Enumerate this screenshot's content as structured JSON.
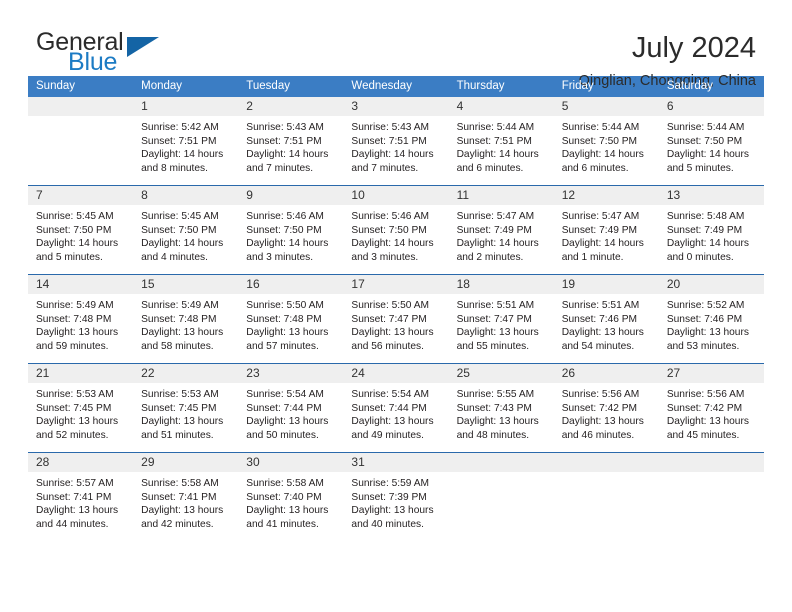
{
  "brand": {
    "name_top": "General",
    "name_bottom": "Blue",
    "accent_color": "#1c7bc4",
    "triangle_color": "#1464a5"
  },
  "header": {
    "title": "July 2024",
    "subtitle": "Qinglian, Chongqing, China"
  },
  "theme": {
    "header_row_bg": "#3b7dc4",
    "row_divider": "#2a69ab",
    "daynum_strip_bg": "#efefef",
    "text": "#231f20"
  },
  "weekdays": [
    "Sunday",
    "Monday",
    "Tuesday",
    "Wednesday",
    "Thursday",
    "Friday",
    "Saturday"
  ],
  "weeks": [
    [
      {
        "day": "",
        "lines": []
      },
      {
        "day": "1",
        "lines": [
          "Sunrise: 5:42 AM",
          "Sunset: 7:51 PM",
          "Daylight: 14 hours",
          "and 8 minutes."
        ]
      },
      {
        "day": "2",
        "lines": [
          "Sunrise: 5:43 AM",
          "Sunset: 7:51 PM",
          "Daylight: 14 hours",
          "and 7 minutes."
        ]
      },
      {
        "day": "3",
        "lines": [
          "Sunrise: 5:43 AM",
          "Sunset: 7:51 PM",
          "Daylight: 14 hours",
          "and 7 minutes."
        ]
      },
      {
        "day": "4",
        "lines": [
          "Sunrise: 5:44 AM",
          "Sunset: 7:51 PM",
          "Daylight: 14 hours",
          "and 6 minutes."
        ]
      },
      {
        "day": "5",
        "lines": [
          "Sunrise: 5:44 AM",
          "Sunset: 7:50 PM",
          "Daylight: 14 hours",
          "and 6 minutes."
        ]
      },
      {
        "day": "6",
        "lines": [
          "Sunrise: 5:44 AM",
          "Sunset: 7:50 PM",
          "Daylight: 14 hours",
          "and 5 minutes."
        ]
      }
    ],
    [
      {
        "day": "7",
        "lines": [
          "Sunrise: 5:45 AM",
          "Sunset: 7:50 PM",
          "Daylight: 14 hours",
          "and 5 minutes."
        ]
      },
      {
        "day": "8",
        "lines": [
          "Sunrise: 5:45 AM",
          "Sunset: 7:50 PM",
          "Daylight: 14 hours",
          "and 4 minutes."
        ]
      },
      {
        "day": "9",
        "lines": [
          "Sunrise: 5:46 AM",
          "Sunset: 7:50 PM",
          "Daylight: 14 hours",
          "and 3 minutes."
        ]
      },
      {
        "day": "10",
        "lines": [
          "Sunrise: 5:46 AM",
          "Sunset: 7:50 PM",
          "Daylight: 14 hours",
          "and 3 minutes."
        ]
      },
      {
        "day": "11",
        "lines": [
          "Sunrise: 5:47 AM",
          "Sunset: 7:49 PM",
          "Daylight: 14 hours",
          "and 2 minutes."
        ]
      },
      {
        "day": "12",
        "lines": [
          "Sunrise: 5:47 AM",
          "Sunset: 7:49 PM",
          "Daylight: 14 hours",
          "and 1 minute."
        ]
      },
      {
        "day": "13",
        "lines": [
          "Sunrise: 5:48 AM",
          "Sunset: 7:49 PM",
          "Daylight: 14 hours",
          "and 0 minutes."
        ]
      }
    ],
    [
      {
        "day": "14",
        "lines": [
          "Sunrise: 5:49 AM",
          "Sunset: 7:48 PM",
          "Daylight: 13 hours",
          "and 59 minutes."
        ]
      },
      {
        "day": "15",
        "lines": [
          "Sunrise: 5:49 AM",
          "Sunset: 7:48 PM",
          "Daylight: 13 hours",
          "and 58 minutes."
        ]
      },
      {
        "day": "16",
        "lines": [
          "Sunrise: 5:50 AM",
          "Sunset: 7:48 PM",
          "Daylight: 13 hours",
          "and 57 minutes."
        ]
      },
      {
        "day": "17",
        "lines": [
          "Sunrise: 5:50 AM",
          "Sunset: 7:47 PM",
          "Daylight: 13 hours",
          "and 56 minutes."
        ]
      },
      {
        "day": "18",
        "lines": [
          "Sunrise: 5:51 AM",
          "Sunset: 7:47 PM",
          "Daylight: 13 hours",
          "and 55 minutes."
        ]
      },
      {
        "day": "19",
        "lines": [
          "Sunrise: 5:51 AM",
          "Sunset: 7:46 PM",
          "Daylight: 13 hours",
          "and 54 minutes."
        ]
      },
      {
        "day": "20",
        "lines": [
          "Sunrise: 5:52 AM",
          "Sunset: 7:46 PM",
          "Daylight: 13 hours",
          "and 53 minutes."
        ]
      }
    ],
    [
      {
        "day": "21",
        "lines": [
          "Sunrise: 5:53 AM",
          "Sunset: 7:45 PM",
          "Daylight: 13 hours",
          "and 52 minutes."
        ]
      },
      {
        "day": "22",
        "lines": [
          "Sunrise: 5:53 AM",
          "Sunset: 7:45 PM",
          "Daylight: 13 hours",
          "and 51 minutes."
        ]
      },
      {
        "day": "23",
        "lines": [
          "Sunrise: 5:54 AM",
          "Sunset: 7:44 PM",
          "Daylight: 13 hours",
          "and 50 minutes."
        ]
      },
      {
        "day": "24",
        "lines": [
          "Sunrise: 5:54 AM",
          "Sunset: 7:44 PM",
          "Daylight: 13 hours",
          "and 49 minutes."
        ]
      },
      {
        "day": "25",
        "lines": [
          "Sunrise: 5:55 AM",
          "Sunset: 7:43 PM",
          "Daylight: 13 hours",
          "and 48 minutes."
        ]
      },
      {
        "day": "26",
        "lines": [
          "Sunrise: 5:56 AM",
          "Sunset: 7:42 PM",
          "Daylight: 13 hours",
          "and 46 minutes."
        ]
      },
      {
        "day": "27",
        "lines": [
          "Sunrise: 5:56 AM",
          "Sunset: 7:42 PM",
          "Daylight: 13 hours",
          "and 45 minutes."
        ]
      }
    ],
    [
      {
        "day": "28",
        "lines": [
          "Sunrise: 5:57 AM",
          "Sunset: 7:41 PM",
          "Daylight: 13 hours",
          "and 44 minutes."
        ]
      },
      {
        "day": "29",
        "lines": [
          "Sunrise: 5:58 AM",
          "Sunset: 7:41 PM",
          "Daylight: 13 hours",
          "and 42 minutes."
        ]
      },
      {
        "day": "30",
        "lines": [
          "Sunrise: 5:58 AM",
          "Sunset: 7:40 PM",
          "Daylight: 13 hours",
          "and 41 minutes."
        ]
      },
      {
        "day": "31",
        "lines": [
          "Sunrise: 5:59 AM",
          "Sunset: 7:39 PM",
          "Daylight: 13 hours",
          "and 40 minutes."
        ]
      },
      {
        "day": "",
        "lines": []
      },
      {
        "day": "",
        "lines": []
      },
      {
        "day": "",
        "lines": []
      }
    ]
  ]
}
